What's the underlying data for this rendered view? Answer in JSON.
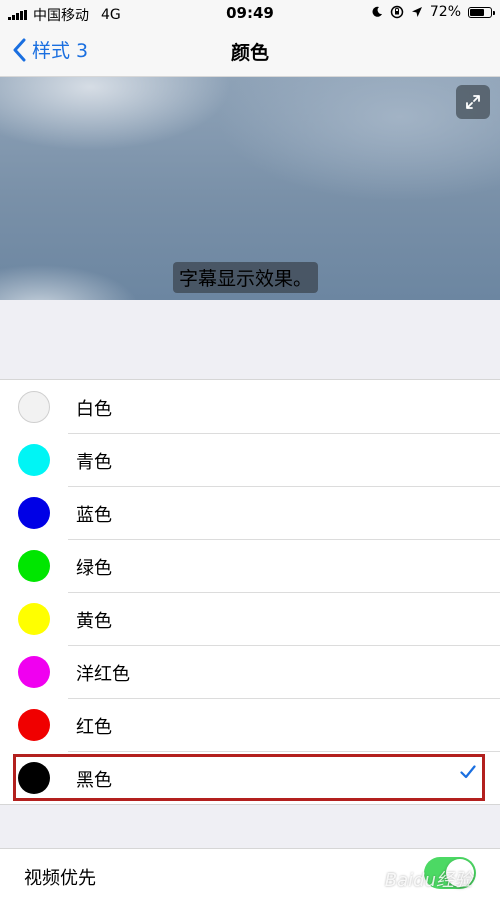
{
  "status_bar": {
    "carrier": "中国移动",
    "network": "4G",
    "time": "09:49",
    "battery_percent": "72%",
    "battery_level": 0.72,
    "icons": [
      "signal-icon",
      "moon-icon",
      "rotation-lock-icon",
      "location-icon",
      "battery-icon"
    ]
  },
  "nav": {
    "back_label": "样式 3",
    "title": "颜色",
    "accent_color": "#1a6fe0"
  },
  "preview": {
    "caption": "字幕显示效果。",
    "expand_icon": "expand-icon"
  },
  "colors": [
    {
      "label": "白色",
      "swatch": "#f2f2f2",
      "selected": false
    },
    {
      "label": "青色",
      "swatch": "#00f5f5",
      "selected": false
    },
    {
      "label": "蓝色",
      "swatch": "#0000e6",
      "selected": false
    },
    {
      "label": "绿色",
      "swatch": "#00e600",
      "selected": false
    },
    {
      "label": "黄色",
      "swatch": "#ffff00",
      "selected": false
    },
    {
      "label": "洋红色",
      "swatch": "#f000f0",
      "selected": false
    },
    {
      "label": "红色",
      "swatch": "#f00000",
      "selected": false
    },
    {
      "label": "黑色",
      "swatch": "#000000",
      "selected": true
    }
  ],
  "settings": {
    "video_priority_label": "视频优先",
    "video_priority_on": true
  },
  "watermark": "Baidu经验"
}
